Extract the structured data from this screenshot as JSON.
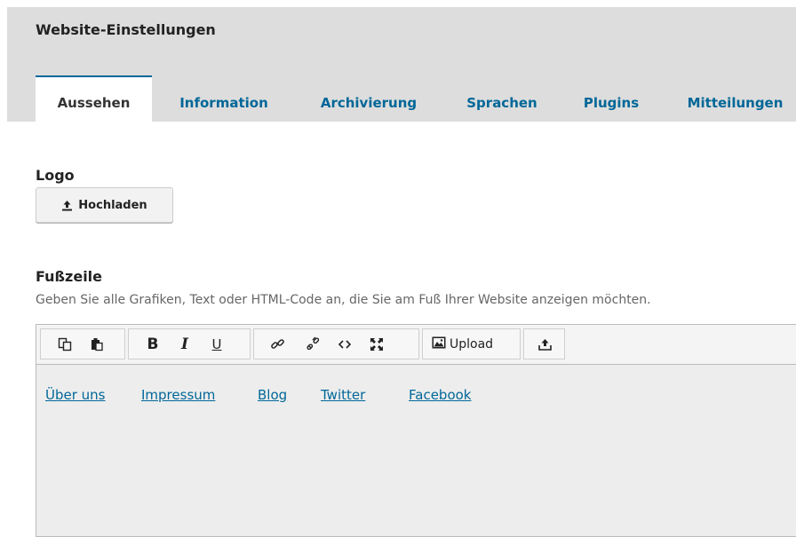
{
  "header": {
    "title": "Website-Einstellungen",
    "tabs": [
      {
        "label": "Aussehen",
        "active": true
      },
      {
        "label": "Information",
        "active": false
      },
      {
        "label": "Archivierung",
        "active": false
      },
      {
        "label": "Sprachen",
        "active": false
      },
      {
        "label": "Plugins",
        "active": false
      },
      {
        "label": "Mitteilungen",
        "active": false
      }
    ]
  },
  "logo": {
    "label": "Logo",
    "upload_button": "Hochladen",
    "upload_icon": "upload-icon"
  },
  "footer": {
    "label": "Fußzeile",
    "description": "Geben Sie alle Grafiken, Text oder HTML-Code an, die Sie am Fuß Ihrer Website anzeigen möchten.",
    "toolbar": {
      "icons": [
        "copy-icon",
        "paste-icon",
        "bold-icon",
        "italic-icon",
        "underline-icon",
        "link-icon",
        "unlink-icon",
        "code-icon",
        "fullscreen-icon",
        "image-upload-icon",
        "file-upload-icon"
      ],
      "bold": "B",
      "italic": "I",
      "underline": "U",
      "upload_label": "Upload"
    },
    "content_links": [
      "Über uns",
      "Impressum",
      "Blog",
      "Twitter",
      "Facebook"
    ]
  },
  "colors": {
    "link": "#006798",
    "header_bg": "#dddddd",
    "editor_bg": "#ededed"
  }
}
